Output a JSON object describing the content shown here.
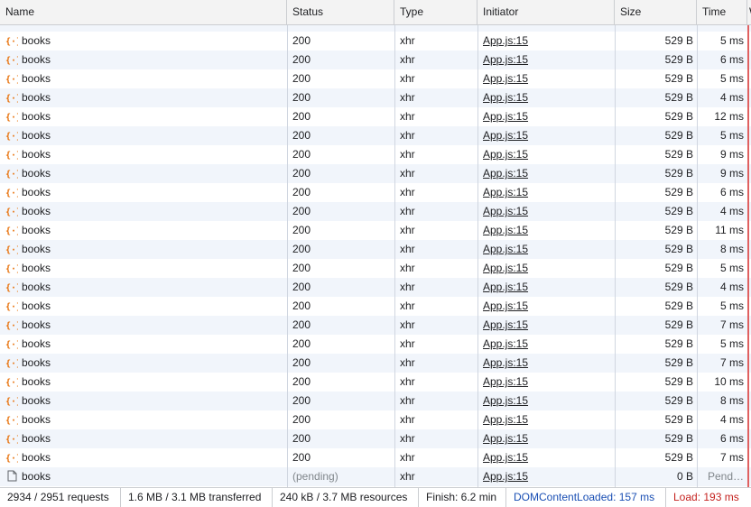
{
  "columns": {
    "name": "Name",
    "status": "Status",
    "type": "Type",
    "initiator": "Initiator",
    "size": "Size",
    "time": "Time",
    "waterfall": "W"
  },
  "rows": [
    {
      "name": "books",
      "status": "200",
      "type": "xhr",
      "initiator": "App.js:15",
      "size": "529 B",
      "time": "5 ms"
    },
    {
      "name": "books",
      "status": "200",
      "type": "xhr",
      "initiator": "App.js:15",
      "size": "529 B",
      "time": "6 ms"
    },
    {
      "name": "books",
      "status": "200",
      "type": "xhr",
      "initiator": "App.js:15",
      "size": "529 B",
      "time": "5 ms"
    },
    {
      "name": "books",
      "status": "200",
      "type": "xhr",
      "initiator": "App.js:15",
      "size": "529 B",
      "time": "4 ms"
    },
    {
      "name": "books",
      "status": "200",
      "type": "xhr",
      "initiator": "App.js:15",
      "size": "529 B",
      "time": "12 ms"
    },
    {
      "name": "books",
      "status": "200",
      "type": "xhr",
      "initiator": "App.js:15",
      "size": "529 B",
      "time": "5 ms"
    },
    {
      "name": "books",
      "status": "200",
      "type": "xhr",
      "initiator": "App.js:15",
      "size": "529 B",
      "time": "9 ms"
    },
    {
      "name": "books",
      "status": "200",
      "type": "xhr",
      "initiator": "App.js:15",
      "size": "529 B",
      "time": "9 ms"
    },
    {
      "name": "books",
      "status": "200",
      "type": "xhr",
      "initiator": "App.js:15",
      "size": "529 B",
      "time": "6 ms"
    },
    {
      "name": "books",
      "status": "200",
      "type": "xhr",
      "initiator": "App.js:15",
      "size": "529 B",
      "time": "4 ms"
    },
    {
      "name": "books",
      "status": "200",
      "type": "xhr",
      "initiator": "App.js:15",
      "size": "529 B",
      "time": "11 ms"
    },
    {
      "name": "books",
      "status": "200",
      "type": "xhr",
      "initiator": "App.js:15",
      "size": "529 B",
      "time": "8 ms"
    },
    {
      "name": "books",
      "status": "200",
      "type": "xhr",
      "initiator": "App.js:15",
      "size": "529 B",
      "time": "5 ms"
    },
    {
      "name": "books",
      "status": "200",
      "type": "xhr",
      "initiator": "App.js:15",
      "size": "529 B",
      "time": "4 ms"
    },
    {
      "name": "books",
      "status": "200",
      "type": "xhr",
      "initiator": "App.js:15",
      "size": "529 B",
      "time": "5 ms"
    },
    {
      "name": "books",
      "status": "200",
      "type": "xhr",
      "initiator": "App.js:15",
      "size": "529 B",
      "time": "7 ms"
    },
    {
      "name": "books",
      "status": "200",
      "type": "xhr",
      "initiator": "App.js:15",
      "size": "529 B",
      "time": "5 ms"
    },
    {
      "name": "books",
      "status": "200",
      "type": "xhr",
      "initiator": "App.js:15",
      "size": "529 B",
      "time": "7 ms"
    },
    {
      "name": "books",
      "status": "200",
      "type": "xhr",
      "initiator": "App.js:15",
      "size": "529 B",
      "time": "10 ms"
    },
    {
      "name": "books",
      "status": "200",
      "type": "xhr",
      "initiator": "App.js:15",
      "size": "529 B",
      "time": "8 ms"
    },
    {
      "name": "books",
      "status": "200",
      "type": "xhr",
      "initiator": "App.js:15",
      "size": "529 B",
      "time": "4 ms"
    },
    {
      "name": "books",
      "status": "200",
      "type": "xhr",
      "initiator": "App.js:15",
      "size": "529 B",
      "time": "6 ms"
    },
    {
      "name": "books",
      "status": "200",
      "type": "xhr",
      "initiator": "App.js:15",
      "size": "529 B",
      "time": "7 ms"
    },
    {
      "name": "books",
      "status": "(pending)",
      "type": "xhr",
      "initiator": "App.js:15",
      "size": "0 B",
      "time": "Pend…",
      "pending": true
    }
  ],
  "footer": {
    "requests": "2934 / 2951 requests",
    "transferred": "1.6 MB / 3.1 MB transferred",
    "resources": "240 kB / 3.7 MB resources",
    "finish": "Finish: 6.2 min",
    "dom_content_loaded": "DOMContentLoaded: 157 ms",
    "load": "Load: 193 ms"
  },
  "colors": {
    "xhr_icon": "#e8710a",
    "dom_content_loaded": "#1a4fb4",
    "load": "#c5221f",
    "row_stripe": "#f1f5fb"
  },
  "icons": {
    "xhr": "xhr-braces-icon",
    "document": "document-icon"
  }
}
